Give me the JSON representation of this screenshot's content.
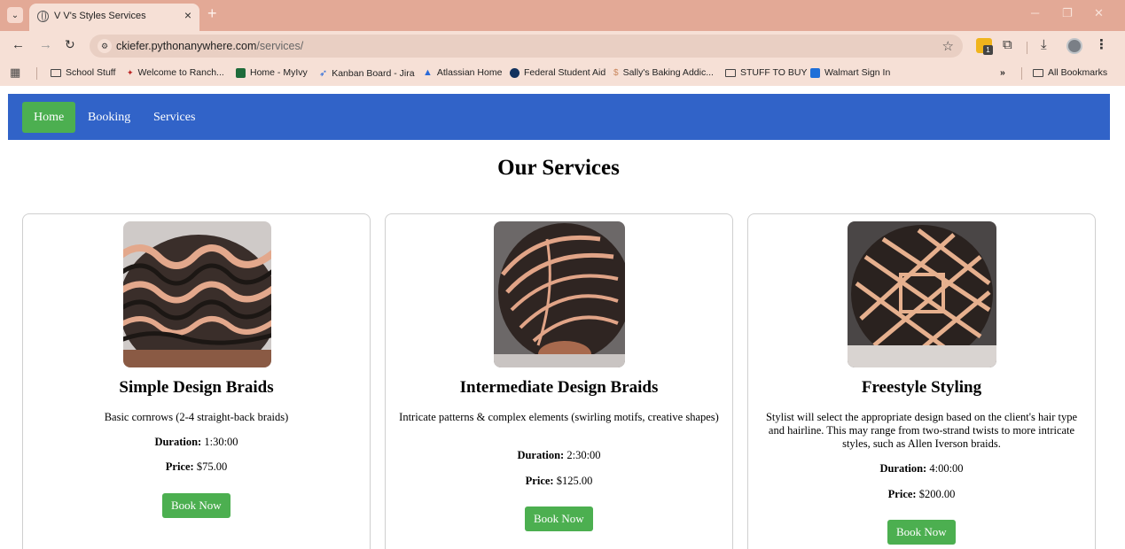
{
  "browser": {
    "tab_title": "V V's Styles Services",
    "url_host": "ckiefer.pythonanywhere.com",
    "url_path": "/services/",
    "bookmarks": [
      {
        "label": "School Stuff",
        "icon": "folder-icon"
      },
      {
        "label": "Welcome to Ranch...",
        "icon": "ranch-icon"
      },
      {
        "label": "Home - MyIvy",
        "icon": "ivy-icon"
      },
      {
        "label": "Kanban Board - Jira",
        "icon": "jira-icon"
      },
      {
        "label": "Atlassian Home",
        "icon": "atlassian-icon"
      },
      {
        "label": "Federal Student Aid",
        "icon": "fsa-icon"
      },
      {
        "label": "Sally's Baking Addic...",
        "icon": "sally-icon"
      },
      {
        "label": "STUFF TO BUY",
        "icon": "folder-icon"
      },
      {
        "label": "Walmart Sign In",
        "icon": "walmart-icon"
      }
    ],
    "overflow_label": "»",
    "all_bookmarks_label": "All Bookmarks"
  },
  "nav": {
    "items": [
      {
        "label": "Home",
        "active": true
      },
      {
        "label": "Booking",
        "active": false
      },
      {
        "label": "Services",
        "active": false
      }
    ]
  },
  "page": {
    "title": "Our Services"
  },
  "services": [
    {
      "name": "Simple Design Braids",
      "description": "Basic cornrows (2-4 straight-back braids)",
      "duration_label": "Duration:",
      "duration": "1:30:00",
      "price_label": "Price:",
      "price": "$75.00",
      "button_label": "Book Now"
    },
    {
      "name": "Intermediate Design Braids",
      "description": "Intricate patterns & complex elements (swirling motifs, creative shapes)",
      "duration_label": "Duration:",
      "duration": "2:30:00",
      "price_label": "Price:",
      "price": "$125.00",
      "button_label": "Book Now"
    },
    {
      "name": "Freestyle Styling",
      "description": "Stylist will select the appropriate design based on the client's hair type and hairline. This may range from two-strand twists to more intricate styles, such as Allen Iverson braids.",
      "duration_label": "Duration:",
      "duration": "4:00:00",
      "price_label": "Price:",
      "price": "$200.00",
      "button_label": "Book Now"
    }
  ],
  "colors": {
    "nav_bg": "#3163c8",
    "accent_green": "#4caf50",
    "tabstrip": "#e3a996",
    "toolbar": "#f6e0d6"
  }
}
